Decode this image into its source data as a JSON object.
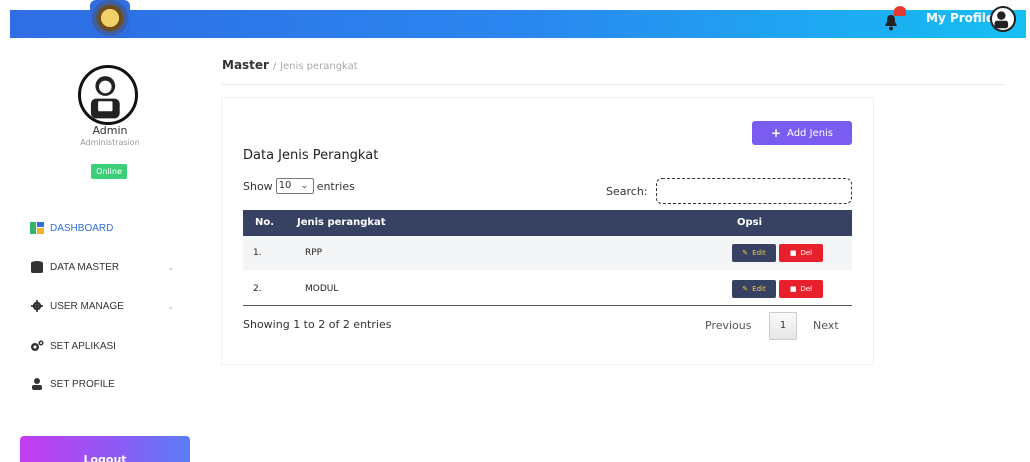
{
  "header": {
    "profile_label": "My Profile",
    "colors": {
      "bar_start": "#2f6de3",
      "bar_end": "#16bff3"
    },
    "icons": [
      "logo",
      "bell-icon",
      "profile-avatar"
    ]
  },
  "sidebar": {
    "user_name": "Admin",
    "user_role": "Administrasion",
    "status": "Online",
    "items": [
      {
        "label": "DASHBOARD",
        "icon": "dashboard-icon",
        "active": true
      },
      {
        "label": "DATA MASTER",
        "icon": "database-icon",
        "has_submenu": true
      },
      {
        "label": "USER MANAGE",
        "icon": "gear-icon",
        "has_submenu": true
      },
      {
        "label": "SET APLIKASI",
        "icon": "gears-icon"
      },
      {
        "label": "SET PROFILE",
        "icon": "user-icon"
      }
    ],
    "logout_label": "Logout"
  },
  "breadcrumb": {
    "root": "Master",
    "separator": "/",
    "current": "Jenis perangkat"
  },
  "card": {
    "title": "Data Jenis Perangkat",
    "add_button": "Add Jenis",
    "show_label": "Show",
    "entries_value": "10",
    "entries_label": "entries",
    "search_label": "Search:",
    "search_value": "",
    "columns": [
      "No.",
      "Jenis perangkat",
      "Opsi"
    ],
    "rows": [
      {
        "no": "1.",
        "jenis": "RPP",
        "edit": "Edit",
        "del": "Del"
      },
      {
        "no": "2.",
        "jenis": "MODUL",
        "edit": "Edit",
        "del": "Del"
      }
    ],
    "info": "Showing 1 to 2 of 2 entries",
    "pagination": {
      "prev": "Previous",
      "page": "1",
      "next": "Next"
    }
  }
}
